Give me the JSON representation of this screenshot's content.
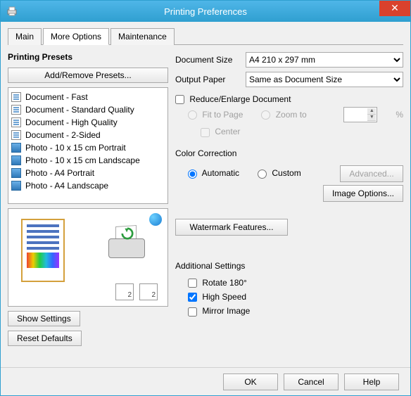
{
  "title": "Printing Preferences",
  "tabs": {
    "main": "Main",
    "more": "More Options",
    "maint": "Maintenance"
  },
  "presets": {
    "title": "Printing Presets",
    "addRemove": "Add/Remove Presets...",
    "items": [
      "Document - Fast",
      "Document - Standard Quality",
      "Document - High Quality",
      "Document - 2-Sided",
      "Photo - 10 x 15 cm Portrait",
      "Photo - 10 x 15 cm Landscape",
      "Photo - A4 Portrait",
      "Photo - A4 Landscape"
    ]
  },
  "showSettings": "Show Settings",
  "resetDefaults": "Reset Defaults",
  "docSize": {
    "label": "Document Size",
    "value": "A4 210 x 297 mm"
  },
  "outPaper": {
    "label": "Output Paper",
    "value": "Same as Document Size"
  },
  "reduce": {
    "label": "Reduce/Enlarge Document",
    "fit": "Fit to Page",
    "zoom": "Zoom to",
    "percent": "%",
    "center": "Center"
  },
  "color": {
    "label": "Color Correction",
    "auto": "Automatic",
    "custom": "Custom",
    "advanced": "Advanced...",
    "imageOptions": "Image Options..."
  },
  "watermark": "Watermark Features...",
  "addl": {
    "label": "Additional Settings",
    "rotate": "Rotate 180°",
    "highSpeed": "High Speed",
    "mirror": "Mirror Image"
  },
  "footer": {
    "ok": "OK",
    "cancel": "Cancel",
    "help": "Help"
  }
}
